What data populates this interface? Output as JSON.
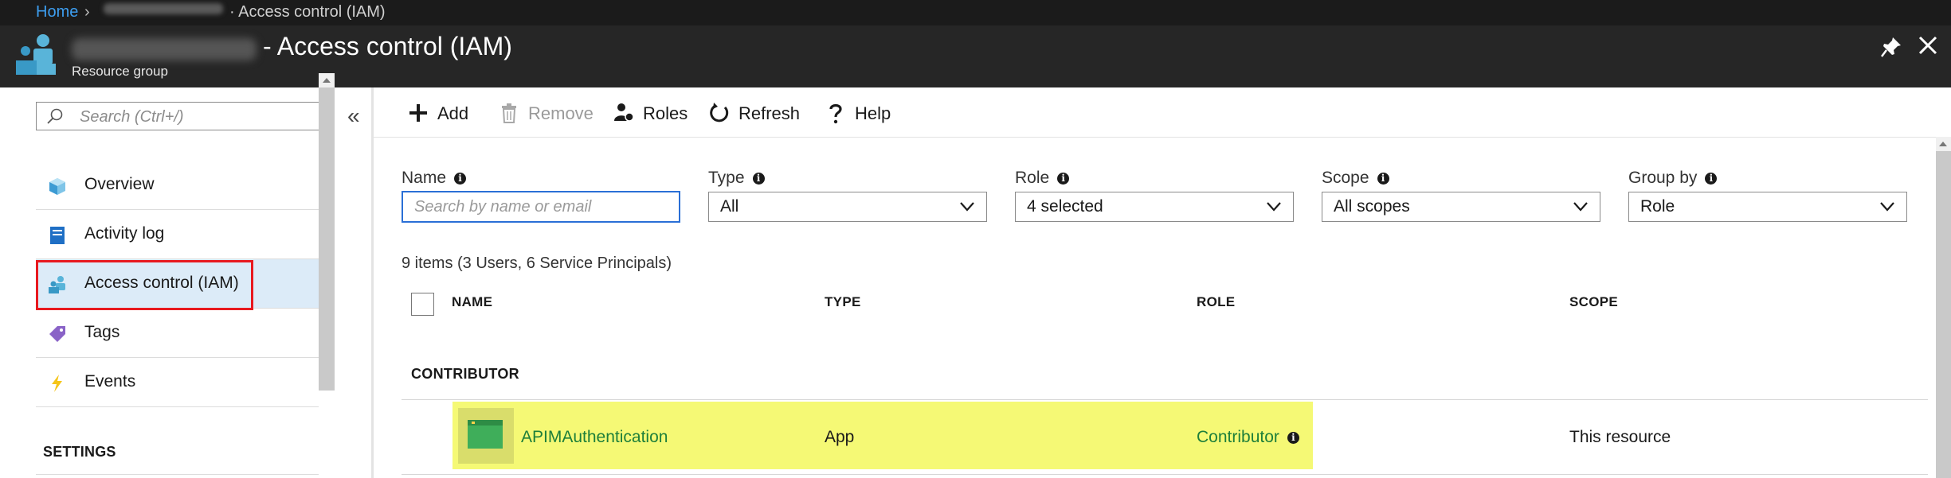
{
  "breadcrumb": {
    "home": "Home",
    "separator": "›",
    "current": "· Access control (IAM)"
  },
  "blade": {
    "title": "- Access control (IAM)",
    "subtitle": "Resource group",
    "icon": "resource-group-icon"
  },
  "window_controls": {
    "pin": "pin-icon",
    "close": "close-icon"
  },
  "nav": {
    "search_placeholder": "Search (Ctrl+/)",
    "collapse": "«",
    "items": [
      {
        "label": "Overview",
        "icon": "overview-cube-icon"
      },
      {
        "label": "Activity log",
        "icon": "activity-log-icon"
      },
      {
        "label": "Access control (IAM)",
        "icon": "iam-people-icon",
        "selected": true
      },
      {
        "label": "Tags",
        "icon": "tag-icon"
      },
      {
        "label": "Events",
        "icon": "lightning-icon"
      }
    ],
    "settings_heading": "SETTINGS"
  },
  "toolbar": {
    "add": "Add",
    "remove": "Remove",
    "roles": "Roles",
    "refresh": "Refresh",
    "help": "Help"
  },
  "filters": {
    "name_label": "Name",
    "name_placeholder": "Search by name or email",
    "type_label": "Type",
    "type_value": "All",
    "role_label": "Role",
    "role_value": "4 selected",
    "scope_label": "Scope",
    "scope_value": "All scopes",
    "groupby_label": "Group by",
    "groupby_value": "Role"
  },
  "summary": "9 items (3 Users, 6 Service Principals)",
  "table": {
    "columns": [
      "NAME",
      "TYPE",
      "ROLE",
      "SCOPE"
    ],
    "group": "CONTRIBUTOR",
    "rows": [
      {
        "name": "APIMAuthentication",
        "type": "App",
        "role": "Contributor",
        "scope": "This resource",
        "icon": "app-icon"
      }
    ]
  },
  "colors": {
    "chrome_dark": "#262626",
    "link_blue": "#3d9ef0",
    "link_green": "#1e7f3a",
    "selected_nav": "#dcebf8",
    "highlight_red": "#e8191f",
    "row_highlight": "#f5f975"
  }
}
